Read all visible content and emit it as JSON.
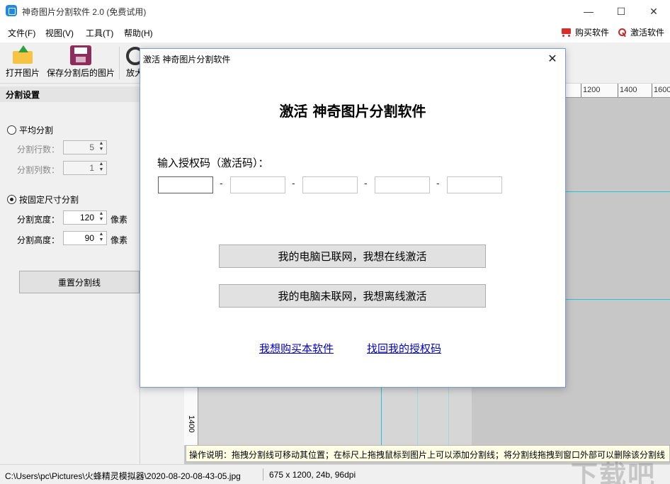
{
  "window": {
    "title": "神奇图片分割软件 2.0 (免费试用)",
    "minimize_icon": "minimize-icon",
    "maximize_icon": "maximize-icon",
    "close_icon": "close-icon"
  },
  "menu": {
    "items": [
      "文件(F)",
      "视图(V)",
      "工具(T)",
      "帮助(H)"
    ],
    "buy_label": "购买软件",
    "activate_label": "激活软件"
  },
  "toolbar": {
    "open_label": "打开图片",
    "save_label": "保存分割后的图片",
    "zoom_label": "放大"
  },
  "panel": {
    "header": "分割设置",
    "even_split_label": "平均分割",
    "rows_label": "分割行数：",
    "rows_value": "5",
    "cols_label": "分割列数：",
    "cols_value": "1",
    "fixed_split_label": "按固定尺寸分割",
    "width_label": "分割宽度：",
    "width_value": "120",
    "height_label": "分割高度：",
    "height_value": "90",
    "unit": "像素",
    "reset_label": "重置分割线",
    "selected_mode": "按固定尺寸分割"
  },
  "canvas": {
    "ruler_top_labels": [
      "1200",
      "1400",
      "1600"
    ],
    "ruler_left_label": "1400"
  },
  "hint": "操作说明：拖拽分割线可移动其位置；在标尺上拖拽鼠标到图片上可以添加分割线；将分割线拖拽到窗口外部可以删除该分割线",
  "status": {
    "path": "C:\\Users\\pc\\Pictures\\火蜂精灵模拟器\\2020-08-20-08-43-05.jpg",
    "info": "675 x 1200, 24b, 96dpi"
  },
  "dialog": {
    "title": "激活 神奇图片分割软件",
    "heading": "激活 神奇图片分割软件",
    "code_label": "输入授权码（激活码）：",
    "code_values": [
      "",
      "",
      "",
      "",
      ""
    ],
    "dash": "-",
    "online_button": "我的电脑已联网，我想在线激活",
    "offline_button": "我的电脑未联网，我想离线激活",
    "buy_link": "我想购买本软件",
    "recover_link": "找回我的授权码"
  },
  "watermark": "下载吧",
  "colors": {
    "accent_blue": "#1e88e5",
    "guide_line": "#24c4d8",
    "link": "#0000cc",
    "cart_red": "#d32f2f"
  }
}
